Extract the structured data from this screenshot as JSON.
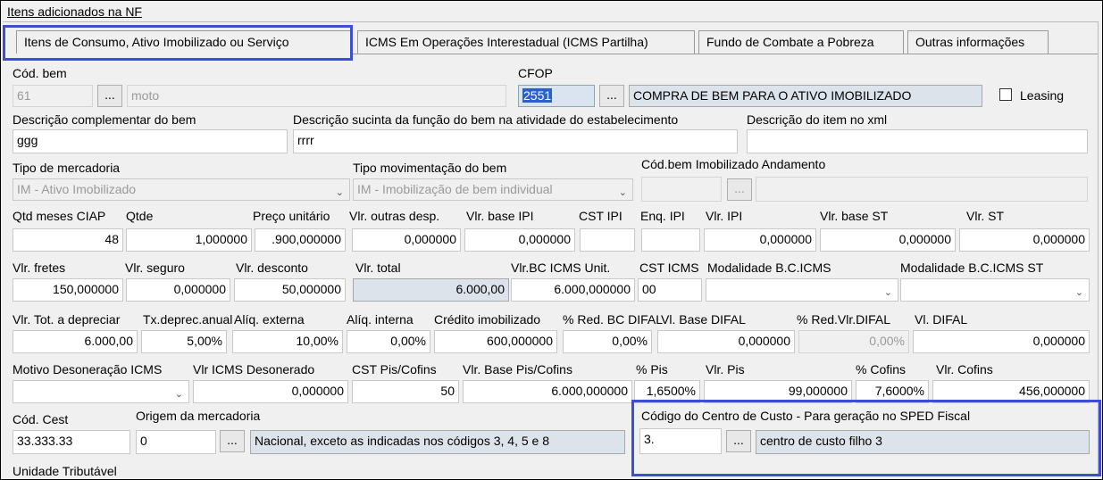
{
  "frame": {
    "title": "Itens adicionados na NF"
  },
  "tabs": [
    {
      "label": "Itens de Consumo,  Ativo Imobilizado ou Serviço"
    },
    {
      "label": "ICMS Em Operações Interestadual (ICMS Partilha)"
    },
    {
      "label": "Fundo de Combate a Pobreza"
    },
    {
      "label": "Outras informações"
    }
  ],
  "ellipsis": "...",
  "bem": {
    "label": "Cód. bem",
    "code": "61",
    "name": "moto"
  },
  "cfop": {
    "label": "CFOP",
    "code": "2551",
    "desc": "COMPRA DE BEM PARA O ATIVO IMOBILIZADO"
  },
  "leasing": {
    "label": "Leasing"
  },
  "desc_compl": {
    "label": "Descrição complementar do bem",
    "value": "ggg"
  },
  "desc_funcao": {
    "label": "Descrição sucinta da função do bem na atividade do estabelecimento",
    "value": "rrrr"
  },
  "desc_xml": {
    "label": "Descrição do item no xml",
    "value": ""
  },
  "tipo_merc": {
    "label": "Tipo de mercadoria",
    "value": "IM - Ativo Imobilizado"
  },
  "tipo_mov": {
    "label": "Tipo movimentação do bem",
    "value": "IM - Imobilização de bem individual"
  },
  "cod_imob": {
    "label": "Cód.bem Imobilizado Andamento"
  },
  "row4": {
    "qtd_meses_label": "Qtd meses CIAP",
    "qtd_meses": "48",
    "qtde_label": "Qtde",
    "qtde": "1,000000",
    "preco_label": "Preço unitário",
    "preco": ".900,000000",
    "outras_label": "Vlr. outras desp.",
    "outras": "0,000000",
    "base_ipi_label": "Vlr. base IPI",
    "base_ipi": "0,000000",
    "cst_ipi_label": "CST IPI",
    "enq_ipi_label": "Enq. IPI",
    "ipi_label": "Vlr. IPI",
    "ipi": "0,000000",
    "base_st_label": "Vlr. base ST",
    "base_st": "0,000000",
    "st_label": "Vlr. ST",
    "st": "0,000000"
  },
  "row5": {
    "fretes_label": "Vlr. fretes",
    "fretes": "150,000000",
    "seguro_label": "Vlr. seguro",
    "seguro": "0,000000",
    "desconto_label": "Vlr. desconto",
    "desconto": "50,000000",
    "total_label": "Vlr. total",
    "total": "6.000,00",
    "bc_icms_label": "Vlr.BC ICMS Unit.",
    "bc_icms": "6.000,000000",
    "cst_icms_label": "CST ICMS",
    "cst_icms": "00",
    "mod_bc_label": "Modalidade B.C.ICMS",
    "mod_bc_st_label": "Modalidade B.C.ICMS ST"
  },
  "row6": {
    "tot_dep_label": "Vlr. Tot. a depreciar",
    "tot_dep": "6.000,00",
    "tx_dep_label": "Tx.deprec.anual",
    "tx_dep": "5,00%",
    "aliq_ext_label": "Alíq. externa",
    "aliq_ext": "10,00%",
    "aliq_int_label": "Alíq. interna",
    "aliq_int": "0,00%",
    "cred_label": "Crédito imobilizado",
    "cred": "600,000000",
    "red_bc_label": "% Red. BC DIFAL",
    "red_bc": "0,00%",
    "base_difal_label": "Vl. Base DIFAL",
    "base_difal": "0,000000",
    "red_vlr_label": "% Red.Vlr.DIFAL",
    "red_vlr": "0,00%",
    "difal_label": "Vl. DIFAL",
    "difal": "0,000000"
  },
  "row7": {
    "motivo_label": "Motivo Desoneração ICMS",
    "icms_des_label": "Vlr ICMS Desonerado",
    "icms_des": "0,000000",
    "cst_pis_label": "CST Pis/Cofins",
    "cst_pis": "50",
    "base_pis_label": "Vlr. Base Pis/Cofins",
    "base_pis": "6.000,000000",
    "pis_pct_label": "% Pis",
    "pis_pct": "1,6500%",
    "pis_label": "Vlr. Pis",
    "pis": "99,000000",
    "cofins_pct_label": "% Cofins",
    "cofins_pct": "7,6000%",
    "cofins_label": "Vlr. Cofins",
    "cofins": "456,000000"
  },
  "row8": {
    "cest_label": "Cód. Cest",
    "cest": "33.333.33",
    "origem_label": "Origem da mercadoria",
    "origem": "0",
    "origem_desc": "Nacional, exceto as indicadas nos códigos 3, 4, 5 e 8",
    "cc_label": "Código do Centro de Custo - Para geração no SPED Fiscal",
    "cc": "3.",
    "cc_desc": "centro de custo filho 3"
  },
  "unidade": {
    "label": "Unidade Tributável"
  },
  "colors": {
    "highlight": "#3c4fd1",
    "cfop_sel": "#2b60c8"
  }
}
